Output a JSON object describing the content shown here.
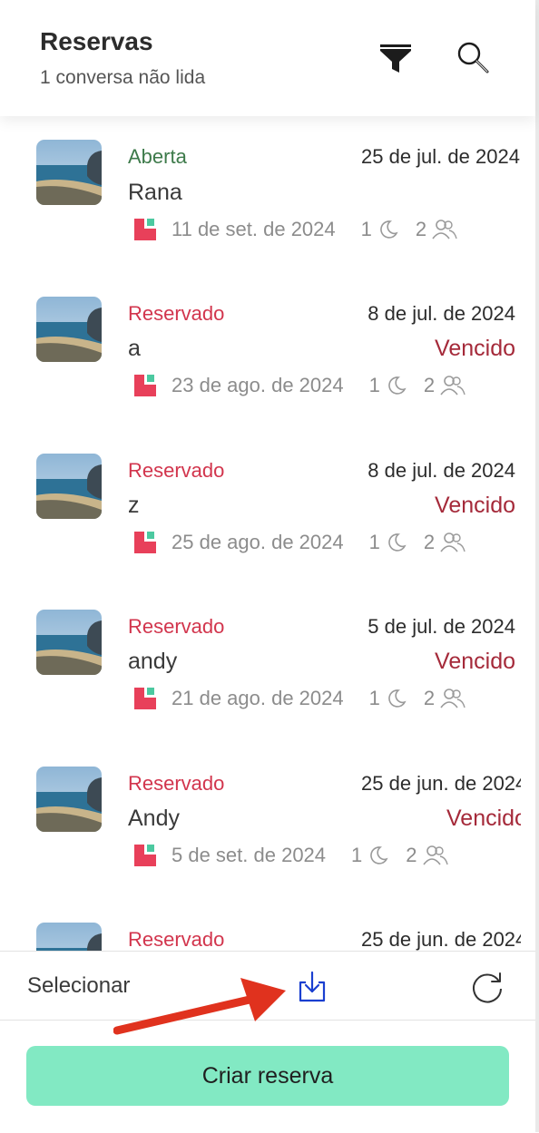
{
  "header": {
    "title": "Reservas",
    "subtitle": "1 conversa não lida",
    "filter_icon": "filter-icon",
    "search_icon": "search-icon"
  },
  "reservations": [
    {
      "status": "Aberta",
      "status_type": "open",
      "date": "25 de jul. de 2024",
      "guest": "Rana",
      "expired": "",
      "checkin": "11 de set. de 2024",
      "nights": "1",
      "guests": "2"
    },
    {
      "status": "Reservado",
      "status_type": "reserved",
      "date": "8 de jul. de 2024",
      "guest": "a",
      "expired": "Vencido",
      "checkin": "23 de ago. de 2024",
      "nights": "1",
      "guests": "2"
    },
    {
      "status": "Reservado",
      "status_type": "reserved",
      "date": "8 de jul. de 2024",
      "guest": "z",
      "expired": "Vencido",
      "checkin": "25 de ago. de 2024",
      "nights": "1",
      "guests": "2"
    },
    {
      "status": "Reservado",
      "status_type": "reserved",
      "date": "5 de jul. de 2024",
      "guest": "andy",
      "expired": "Vencido",
      "checkin": "21 de ago. de 2024",
      "nights": "1",
      "guests": "2"
    },
    {
      "status": "Reservado",
      "status_type": "reserved",
      "date": "25 de jun. de 2024",
      "guest": "Andy",
      "expired": "Vencido",
      "checkin": "5 de set. de 2024",
      "nights": "1",
      "guests": "2"
    },
    {
      "status": "Reservado",
      "status_type": "reserved",
      "date": "25 de jun. de 2024",
      "guest": "",
      "expired": "",
      "checkin": "",
      "nights": "",
      "guests": ""
    }
  ],
  "footer": {
    "select_label": "Selecionar",
    "download_icon": "download-icon",
    "refresh_icon": "refresh-icon",
    "create_label": "Criar reserva"
  },
  "colors": {
    "open": "#3d7a4a",
    "reserved": "#d2354d",
    "expired": "#a52a3a",
    "primary_button": "#82e9c3",
    "annotation_arrow": "#e0321e",
    "download_icon": "#1a3fd0"
  }
}
